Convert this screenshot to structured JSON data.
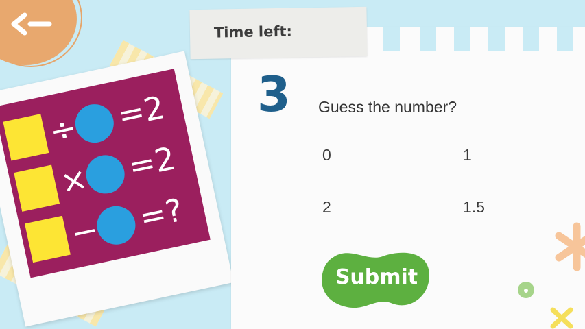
{
  "back": {
    "icon": "back-arrow-icon"
  },
  "timer": {
    "label": "Time left:"
  },
  "question": {
    "number": "3",
    "text": "Guess the number?",
    "options": [
      "0",
      "1",
      "2",
      "1.5"
    ]
  },
  "submit": {
    "label": "Submit"
  },
  "puzzle": {
    "rows": [
      {
        "op": "÷",
        "result": "=2"
      },
      {
        "op": "×",
        "result": "=2"
      },
      {
        "op": "−",
        "result": "=?"
      }
    ]
  },
  "colors": {
    "background": "#c9ebf5",
    "number": "#1f5f8b",
    "submit": "#5db040",
    "puzzle_bg": "#9b1f5e",
    "square": "#fde534",
    "circle": "#2a9fdf"
  }
}
